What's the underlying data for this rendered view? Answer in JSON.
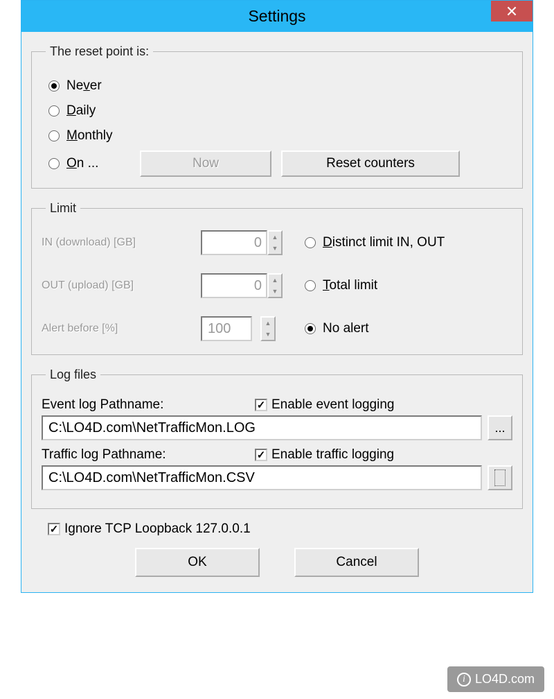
{
  "window": {
    "title": "Settings"
  },
  "resetGroup": {
    "legend": "The reset point is:",
    "options": {
      "never": "Never",
      "daily_pre": "",
      "daily_u": "D",
      "daily_post": "aily",
      "monthly_pre": "",
      "monthly_u": "M",
      "monthly_post": "onthly",
      "on_pre": "",
      "on_u": "O",
      "on_post": "n ..."
    },
    "nowBtn_pre": "",
    "nowBtn_u": "N",
    "nowBtn_post": "ow",
    "resetBtn_pre": "",
    "resetBtn_u": "R",
    "resetBtn_post": "eset counters"
  },
  "limitGroup": {
    "legend": "Limit",
    "inLabel": "IN (download) [GB]",
    "outLabel": "OUT (upload) [GB]",
    "alertLabel": "Alert before [%]",
    "inVal": "0",
    "outVal": "0",
    "alertVal": "100",
    "distinct_pre": "",
    "distinct_u": "D",
    "distinct_post": "istinct limit IN, OUT",
    "total_pre": "",
    "total_u": "T",
    "total_post": "otal limit",
    "noalert": "No alert"
  },
  "logGroup": {
    "legend": "Log files",
    "eventLabel": "Event log Pathname:",
    "enableEvent": "Enable event logging",
    "eventPath": "C:\\LO4D.com\\NetTrafficMon.LOG",
    "trafficLabel": "Traffic log Pathname:",
    "enableTraffic": "Enable traffic logging",
    "trafficPath": "C:\\LO4D.com\\NetTrafficMon.CSV",
    "browse": "..."
  },
  "ignoreLabel": "Ignore TCP Loopback 127.0.0.1",
  "buttons": {
    "ok": "OK",
    "cancel": "Cancel"
  },
  "watermark": "LO4D.com"
}
